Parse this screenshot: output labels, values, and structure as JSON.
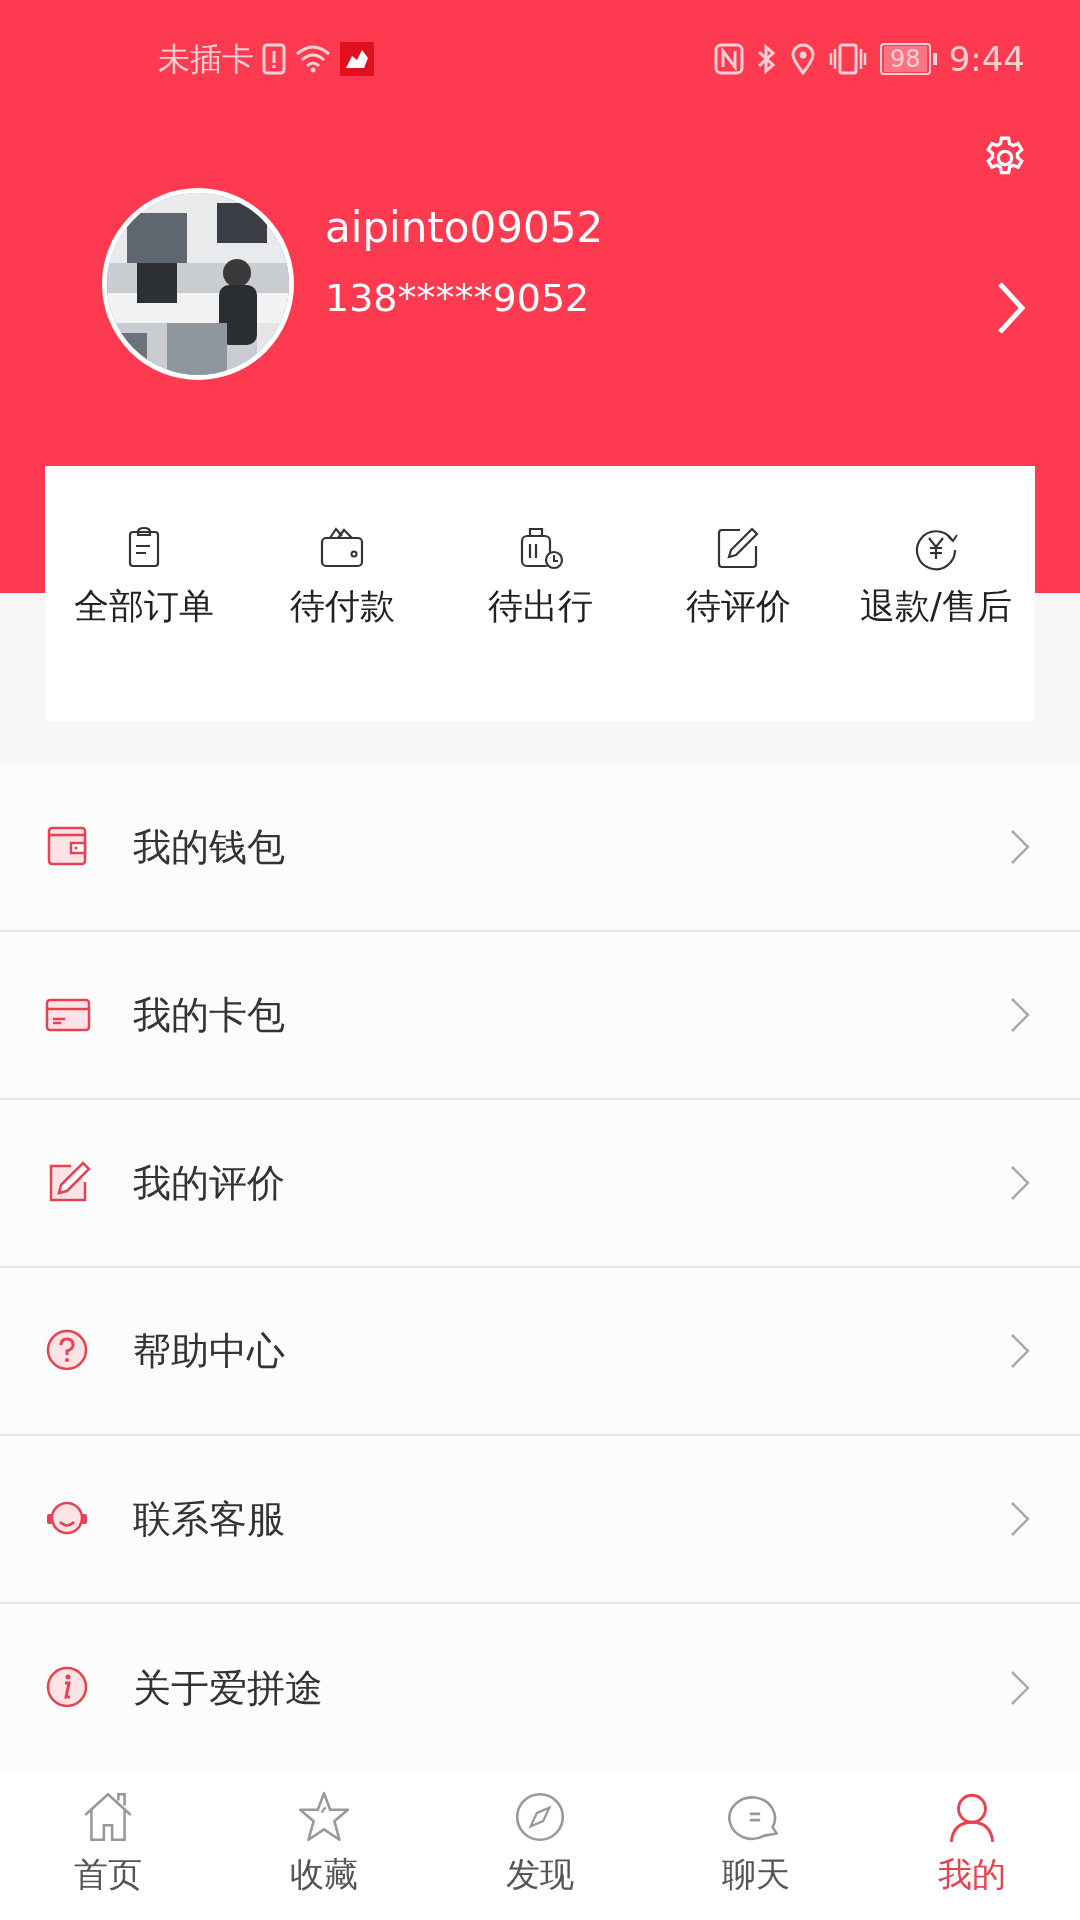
{
  "status_bar": {
    "carrier": "未插卡",
    "battery": "98",
    "time": "9:44"
  },
  "profile": {
    "username": "aipinto09052",
    "phone": "138*****9052"
  },
  "orders": [
    {
      "kind": "clipboard",
      "label": "全部订单"
    },
    {
      "kind": "wallet",
      "label": "待付款"
    },
    {
      "kind": "luggage",
      "label": "待出行"
    },
    {
      "kind": "pencil",
      "label": "待评价"
    },
    {
      "kind": "refund",
      "label": "退款/售后"
    }
  ],
  "menu": [
    {
      "kind": "wallet",
      "label": "我的钱包"
    },
    {
      "kind": "card",
      "label": "我的卡包"
    },
    {
      "kind": "pencil",
      "label": "我的评价"
    },
    {
      "kind": "help",
      "label": "帮助中心"
    },
    {
      "kind": "service",
      "label": "联系客服"
    },
    {
      "kind": "info",
      "label": "关于爱拼途"
    }
  ],
  "tabs": [
    {
      "kind": "home",
      "label": "首页",
      "selected": false
    },
    {
      "kind": "star",
      "label": "收藏",
      "selected": false
    },
    {
      "kind": "compass",
      "label": "发现",
      "selected": false
    },
    {
      "kind": "chat",
      "label": "聊天",
      "selected": false
    },
    {
      "kind": "person",
      "label": "我的",
      "selected": true
    }
  ]
}
